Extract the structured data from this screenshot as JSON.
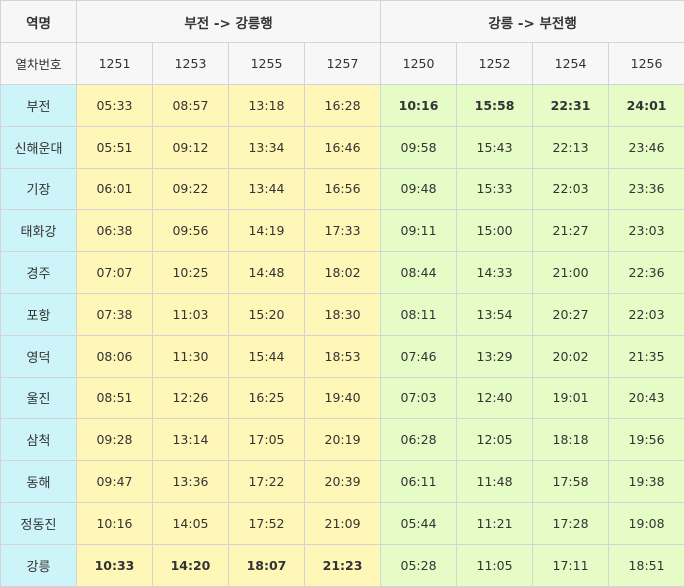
{
  "header": {
    "station_label": "역명",
    "train_no_label": "열차번호",
    "group_down": "부전 -> 강릉행",
    "group_up": "강릉 -> 부전행"
  },
  "trains_down": [
    "1251",
    "1253",
    "1255",
    "1257"
  ],
  "trains_up": [
    "1250",
    "1252",
    "1254",
    "1256"
  ],
  "stations": [
    "부전",
    "신해운대",
    "기장",
    "태화강",
    "경주",
    "포항",
    "영덕",
    "울진",
    "삼척",
    "동해",
    "정동진",
    "강릉"
  ],
  "times_down": [
    [
      "05:33",
      "08:57",
      "13:18",
      "16:28"
    ],
    [
      "05:51",
      "09:12",
      "13:34",
      "16:46"
    ],
    [
      "06:01",
      "09:22",
      "13:44",
      "16:56"
    ],
    [
      "06:38",
      "09:56",
      "14:19",
      "17:33"
    ],
    [
      "07:07",
      "10:25",
      "14:48",
      "18:02"
    ],
    [
      "07:38",
      "11:03",
      "15:20",
      "18:30"
    ],
    [
      "08:06",
      "11:30",
      "15:44",
      "18:53"
    ],
    [
      "08:51",
      "12:26",
      "16:25",
      "19:40"
    ],
    [
      "09:28",
      "13:14",
      "17:05",
      "20:19"
    ],
    [
      "09:47",
      "13:36",
      "17:22",
      "20:39"
    ],
    [
      "10:16",
      "14:05",
      "17:52",
      "21:09"
    ],
    [
      "10:33",
      "14:20",
      "18:07",
      "21:23"
    ]
  ],
  "times_up": [
    [
      "10:16",
      "15:58",
      "22:31",
      "24:01"
    ],
    [
      "09:58",
      "15:43",
      "22:13",
      "23:46"
    ],
    [
      "09:48",
      "15:33",
      "22:03",
      "23:36"
    ],
    [
      "09:11",
      "15:00",
      "21:27",
      "23:03"
    ],
    [
      "08:44",
      "14:33",
      "21:00",
      "22:36"
    ],
    [
      "08:11",
      "13:54",
      "20:27",
      "22:03"
    ],
    [
      "07:46",
      "13:29",
      "20:02",
      "21:35"
    ],
    [
      "07:03",
      "12:40",
      "19:01",
      "20:43"
    ],
    [
      "06:28",
      "12:05",
      "18:18",
      "19:56"
    ],
    [
      "06:11",
      "11:48",
      "17:58",
      "19:38"
    ],
    [
      "05:44",
      "11:21",
      "17:28",
      "19:08"
    ],
    [
      "05:28",
      "11:05",
      "17:11",
      "18:51"
    ]
  ],
  "colors": {
    "station_bg": "#cdf4f9",
    "down_bg": "#fff7b8",
    "up_bg": "#e5fcc7",
    "header_bg": "#f7f7f7"
  }
}
